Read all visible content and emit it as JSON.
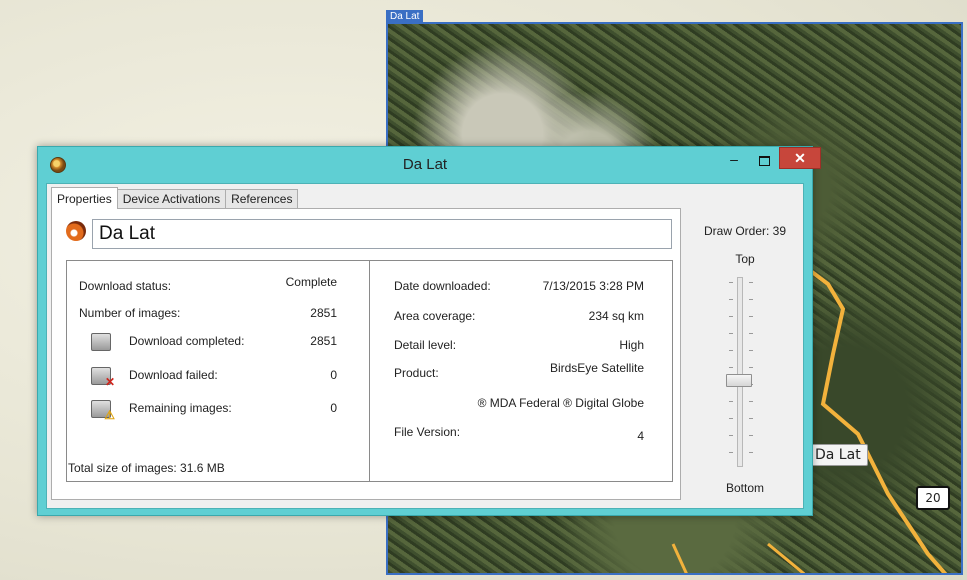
{
  "map": {
    "tab_label": "Da Lat",
    "city_label": "Da Lat",
    "road_shield": "20",
    "road_color": "#f2b23c",
    "frame_color": "#3a6fc4"
  },
  "window": {
    "title": "Da Lat",
    "min_symbol": "–",
    "close_symbol": "✕",
    "accent": "#5fcfd3",
    "close_color": "#c7463b"
  },
  "tabs": [
    "Properties",
    "Device Activations",
    "References"
  ],
  "properties": {
    "name": "Da Lat",
    "left": {
      "download_status_label": "Download status:",
      "download_status_value": "Complete",
      "num_images_label": "Number of images:",
      "num_images_value": "2851",
      "completed_label": "Download completed:",
      "completed_value": "2851",
      "completed_icon": "download-complete-icon",
      "failed_label": "Download failed:",
      "failed_value": "0",
      "failed_icon": "download-failed-icon",
      "remaining_label": "Remaining images:",
      "remaining_value": "0",
      "remaining_icon": "remaining-images-icon"
    },
    "right": {
      "date_label": "Date downloaded:",
      "date_value": "7/13/2015 3:28 PM",
      "area_label": "Area coverage:",
      "area_value": "234 sq km",
      "detail_label": "Detail level:",
      "detail_value": "High",
      "product_label": "Product:",
      "product_value": "BirdsEye Satellite",
      "attribution": "® MDA Federal ® Digital Globe",
      "version_label": "File Version:",
      "version_value": "4"
    },
    "total_size": "Total size of images: 31.6 MB"
  },
  "draw_order": {
    "title": "Draw Order: 39",
    "top": "Top",
    "bottom": "Bottom",
    "slider_level": 0.55
  }
}
